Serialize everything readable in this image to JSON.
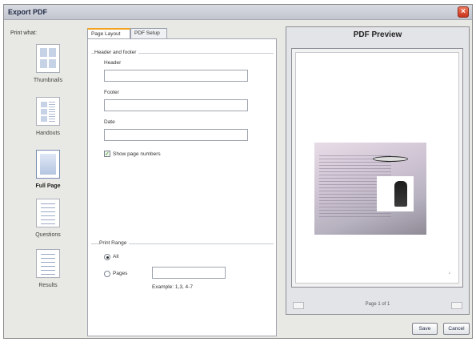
{
  "window": {
    "title": "Export PDF"
  },
  "print_what": {
    "label": "Print what:",
    "options": [
      {
        "label": "Thumbnails",
        "selected": false,
        "icon": "thumbnails-icon"
      },
      {
        "label": "Handouts",
        "selected": false,
        "icon": "handouts-icon"
      },
      {
        "label": "Full Page",
        "selected": true,
        "icon": "full-page-icon"
      },
      {
        "label": "Questions",
        "selected": false,
        "icon": "questions-icon"
      },
      {
        "label": "Results",
        "selected": false,
        "icon": "results-icon"
      }
    ]
  },
  "tabs": [
    {
      "label": "Page Layout",
      "active": true
    },
    {
      "label": "PDF Setup",
      "active": false
    }
  ],
  "header_footer": {
    "group_title": "Header and footer",
    "header_label": "Header",
    "header_value": "",
    "footer_label": "Footer",
    "footer_value": "",
    "date_label": "Date",
    "date_value": "",
    "show_page_numbers_label": "Show page numbers",
    "show_page_numbers_checked": true
  },
  "print_range": {
    "group_title": "Print Range",
    "all_label": "All",
    "all_checked": true,
    "pages_label": "Pages",
    "pages_value": "",
    "example_text": "Example: 1,3, 4-7"
  },
  "preview": {
    "title": "PDF Preview",
    "page_indicator": "Page 1 of 1",
    "page_number": "1"
  },
  "buttons": {
    "save": "Save",
    "cancel": "Cancel"
  },
  "colors": {
    "accent_tab": "#f0a41f",
    "close": "#c8321b"
  }
}
